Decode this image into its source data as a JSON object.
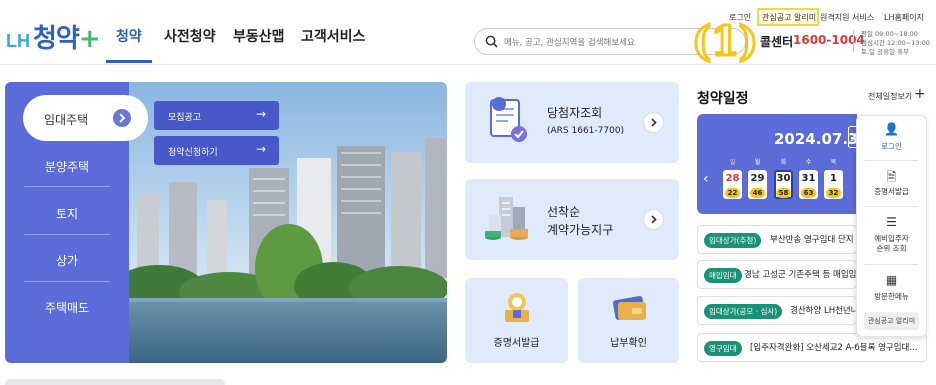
{
  "logo": {
    "lh": "LH",
    "main": "청약",
    "plus": "+"
  },
  "nav": [
    "청약",
    "사전청약",
    "부동산맵",
    "고객서비스"
  ],
  "utility": [
    "로그인",
    "관심공고 알리미",
    "원격지원 서비스",
    "LH홈페이지"
  ],
  "callout_number": "(1)",
  "search": {
    "placeholder": "메뉴, 공고, 관심지역을 검색해보세요"
  },
  "call_center": {
    "label": "콜센터",
    "number": "1600-1004",
    "hours": [
      "평일 09:00~18:00",
      "점심시간 12:00~13:00",
      "토,일 공휴일 휴무"
    ]
  },
  "left_menu": {
    "active": "임대주택",
    "items": [
      "분양주택",
      "토지",
      "상가",
      "주택매도"
    ]
  },
  "sub_menu": [
    "모집공고",
    "청약신청하기"
  ],
  "cards": {
    "winner": {
      "title": "당첨자조회",
      "sub": "(ARS 1661-7700)"
    },
    "first_come": {
      "title": "선착순",
      "sub": "계약가능지구"
    },
    "cert": {
      "title": "증명서발급"
    },
    "payment": {
      "title": "납부확인"
    }
  },
  "schedule": {
    "title": "청약일정",
    "view_all": "전체일정보기",
    "date": "2024.07.30",
    "weekdays": [
      "일",
      "월",
      "화",
      "수",
      "목"
    ],
    "days": [
      {
        "num": "28",
        "count": "22"
      },
      {
        "num": "29",
        "count": "46"
      },
      {
        "num": "30",
        "count": "58"
      },
      {
        "num": "31",
        "count": "63"
      },
      {
        "num": "1",
        "count": "32"
      }
    ],
    "notices": [
      {
        "tag": "임대상가(추첨)",
        "text": "부산반송 영구임대 단지 임"
      },
      {
        "tag": "매입임대",
        "text": "경남 고성군 기존주택 등 매입임"
      },
      {
        "tag": "임대상가(공모 · 심사)",
        "text": "경산하양 LH천년나"
      },
      {
        "tag": "영구임대",
        "text": "[입주자격완화] 오산세교2 A-6블록 영구임대..."
      }
    ]
  },
  "quick_menu": [
    {
      "icon": "person-icon",
      "glyph": "👤",
      "label": "로그인"
    },
    {
      "icon": "document-icon",
      "glyph": "🗎",
      "label": "증명서발급"
    },
    {
      "icon": "list-icon",
      "glyph": "☰",
      "label": "예비입주자\n순위 조회"
    },
    {
      "icon": "grid-icon",
      "glyph": "▦",
      "label": "방문한메뉴"
    }
  ],
  "quick_last": "관심공고 알리미",
  "colors": {
    "primary": "#5b6cd9",
    "brand_blue": "#2f5fc4",
    "tag_green": "#199278",
    "highlight": "#f5c518"
  }
}
